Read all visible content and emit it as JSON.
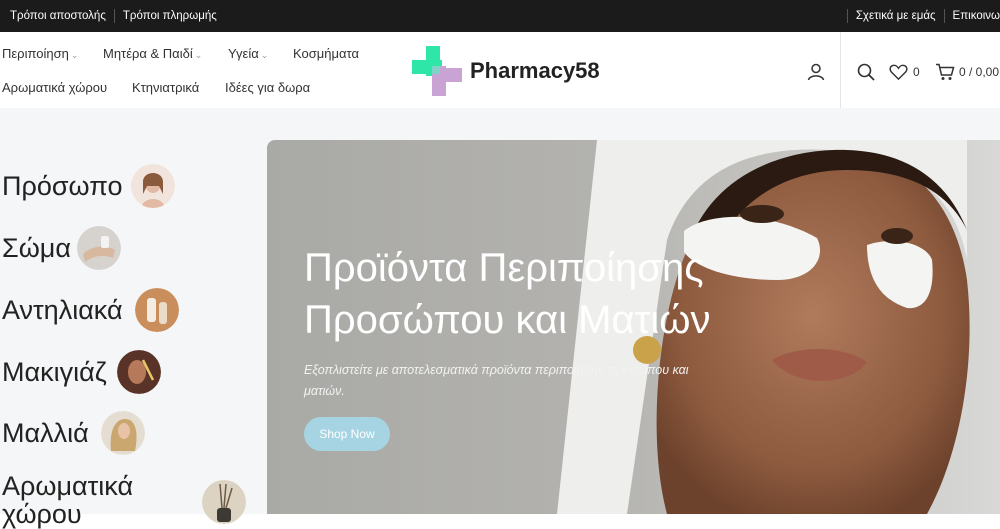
{
  "topbar": {
    "shipping_link": "Τρόποι αποστολής",
    "payment_link": "Τρόποι πληρωμής",
    "about_link": "Σχετικά με εμάς",
    "contact_link": "Επικοινω"
  },
  "nav": {
    "items": [
      {
        "label": "Περιποίηση",
        "has_dropdown": true
      },
      {
        "label": "Μητέρα & Παιδί",
        "has_dropdown": true
      },
      {
        "label": "Υγεία",
        "has_dropdown": true
      },
      {
        "label": "Κοσμήματα",
        "has_dropdown": false
      },
      {
        "label": "Αρωματικά χώρου",
        "has_dropdown": false
      },
      {
        "label": "Κτηνιατρικά",
        "has_dropdown": false
      },
      {
        "label": "Ιδέες για δωρα",
        "has_dropdown": false
      }
    ]
  },
  "logo": {
    "text": "Pharmacy58",
    "colors": {
      "green": "#2ee6a8",
      "purple": "#c8a3d4"
    }
  },
  "header_icons": {
    "account": "user-icon",
    "search": "search-icon",
    "wishlist": "heart-icon",
    "wishlist_count": "0",
    "cart": "cart-icon",
    "cart_summary": "0 / 0,00"
  },
  "categories": [
    {
      "label": "Πρόσωπο",
      "thumb_color": "#e9cfc3"
    },
    {
      "label": "Σώμα",
      "thumb_color": "#c9c3bd"
    },
    {
      "label": "Αντηλιακά",
      "thumb_color": "#c98e5c"
    },
    {
      "label": "Μακιγιάζ",
      "thumb_color": "#7a4a3a"
    },
    {
      "label": "Μαλλιά",
      "thumb_color": "#d8c4a8"
    },
    {
      "label": "Αρωματικά χώρου",
      "thumb_color": "#d9cdb8"
    }
  ],
  "hero": {
    "title_line1": "Προϊόντα Περιποίησης",
    "title_line2": "Προσώπου και Ματιών",
    "subtitle": "Εξοπλιστείτε με αποτελεσματικά προϊόντα περιποίησης προσώπου και ματιών.",
    "button_label": "Shop Now",
    "button_color": "#a7d4e2"
  }
}
